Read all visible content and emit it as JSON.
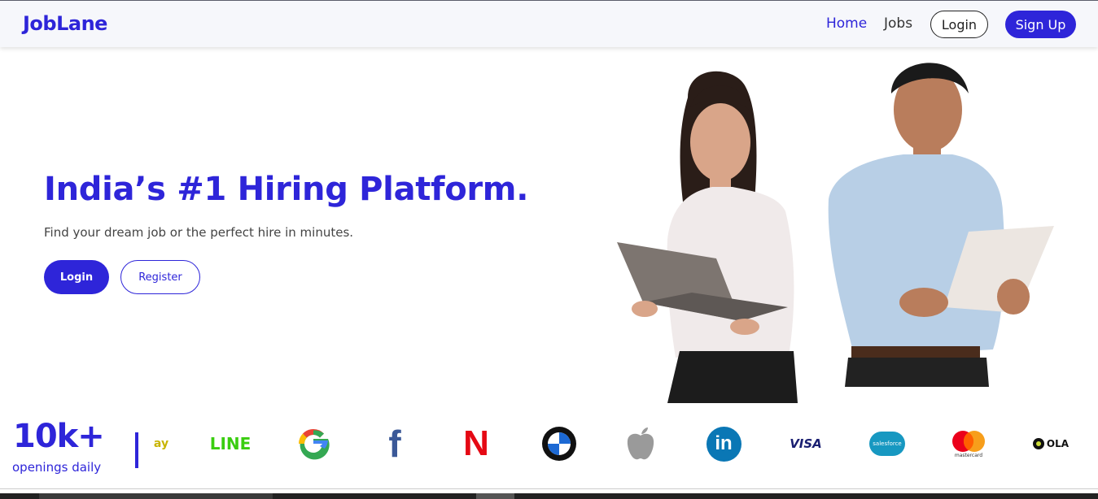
{
  "navbar": {
    "brand": "JobLane",
    "links": {
      "home": "Home",
      "jobs": "Jobs"
    },
    "login_label": "Login",
    "signup_label": "Sign Up"
  },
  "hero": {
    "title": "India’s #1 Hiring Platform.",
    "subtitle": "Find your dream job or the perfect hire in minutes.",
    "login_label": "Login",
    "register_label": "Register"
  },
  "stats": {
    "number": "10k+",
    "label": "openings daily"
  },
  "logos": [
    {
      "name": "ebay-logo-partial",
      "text": "ay"
    },
    {
      "name": "line-logo",
      "text": "LINE"
    },
    {
      "name": "google-logo",
      "text": "G"
    },
    {
      "name": "facebook-logo",
      "text": "f"
    },
    {
      "name": "netflix-logo",
      "text": "N"
    },
    {
      "name": "bmw-logo",
      "text": ""
    },
    {
      "name": "apple-logo",
      "text": ""
    },
    {
      "name": "linkedin-logo",
      "text": "in"
    },
    {
      "name": "visa-logo",
      "text": "VISA"
    },
    {
      "name": "salesforce-logo",
      "text": "salesforce"
    },
    {
      "name": "mastercard-logo",
      "text": "mastercard"
    },
    {
      "name": "ola-logo",
      "text": "OLA"
    }
  ],
  "colors": {
    "brand": "#2e25d9",
    "nav_bg": "#f6f7fb"
  }
}
